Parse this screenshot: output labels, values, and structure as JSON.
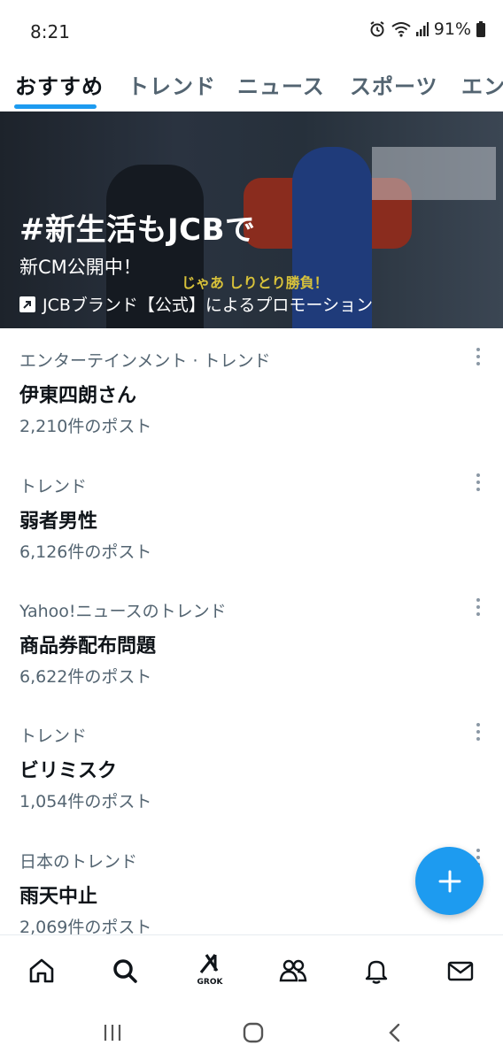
{
  "status_bar": {
    "time": "8:21",
    "battery": "91%",
    "icons": [
      "alarm-icon",
      "wifi-icon",
      "signal-icon",
      "battery-icon"
    ]
  },
  "tabs": [
    {
      "label": "おすすめ",
      "active": true
    },
    {
      "label": "トレンド",
      "active": false
    },
    {
      "label": "ニュース",
      "active": false
    },
    {
      "label": "スポーツ",
      "active": false
    },
    {
      "label": "エン",
      "active": false
    }
  ],
  "promo": {
    "title": "#新生活もJCBで",
    "subtitle": "新CM公開中！",
    "caption": "じゃあ しりとり勝負！",
    "source": "JCBブランド【公式】によるプロモーション"
  },
  "trends": [
    {
      "category": "エンターテインメント · トレンド",
      "name": "伊東四朗さん",
      "count": "2,210件のポスト"
    },
    {
      "category": "トレンド",
      "name": "弱者男性",
      "count": "6,126件のポスト"
    },
    {
      "category": "Yahoo!ニュースのトレンド",
      "name": "商品券配布問題",
      "count": "6,622件のポスト"
    },
    {
      "category": "トレンド",
      "name": "ビリミスク",
      "count": "1,054件のポスト"
    },
    {
      "category": "日本のトレンド",
      "name": "雨天中止",
      "count": "2,069件のポスト"
    }
  ],
  "bottom_nav": {
    "items": [
      "home-icon",
      "search-icon",
      "grok-icon",
      "communities-icon",
      "notifications-icon",
      "messages-icon"
    ],
    "grok_label": "GROK"
  },
  "system_nav": [
    "recents-icon",
    "home-circle-icon",
    "back-icon"
  ],
  "colors": {
    "accent": "#1d9bf0",
    "text_primary": "#0f1419",
    "text_secondary": "#536471"
  }
}
